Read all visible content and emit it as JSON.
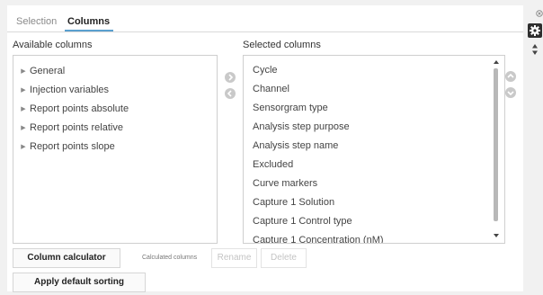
{
  "tabs": [
    {
      "label": "Selection"
    },
    {
      "label": "Columns"
    }
  ],
  "available": {
    "heading": "Available columns",
    "items": [
      {
        "label": "General"
      },
      {
        "label": "Injection variables"
      },
      {
        "label": "Report points absolute"
      },
      {
        "label": "Report points relative"
      },
      {
        "label": "Report points slope"
      }
    ]
  },
  "selected": {
    "heading": "Selected columns",
    "items": [
      {
        "label": "Cycle"
      },
      {
        "label": "Channel"
      },
      {
        "label": "Sensorgram type"
      },
      {
        "label": "Analysis step purpose"
      },
      {
        "label": "Analysis step name"
      },
      {
        "label": "Excluded"
      },
      {
        "label": "Curve markers"
      },
      {
        "label": "Capture 1 Solution"
      },
      {
        "label": "Capture 1 Control type"
      },
      {
        "label": "Capture 1 Concentration (nM)"
      }
    ]
  },
  "buttons": {
    "column_calculator": "Column calculator",
    "calculated_columns_label": "Calculated columns",
    "rename": "Rename",
    "delete": "Delete",
    "apply_default_sorting": "Apply default sorting"
  },
  "colors": {
    "accent": "#5aa0cf",
    "panel_bg": "#ffffff",
    "page_bg": "#f1f1f1",
    "circle_button": "#c9c9c9",
    "disabled_text": "#c4c4c4"
  },
  "icons": {
    "tree_arrow": "caret-right-icon",
    "move_right": "arrow-right-circle-icon",
    "move_left": "arrow-left-circle-icon",
    "move_up": "arrow-up-circle-icon",
    "move_down": "arrow-down-circle-icon",
    "settings": "gear-icon",
    "close": "close-icon",
    "sort": "sort-updown-icon"
  }
}
